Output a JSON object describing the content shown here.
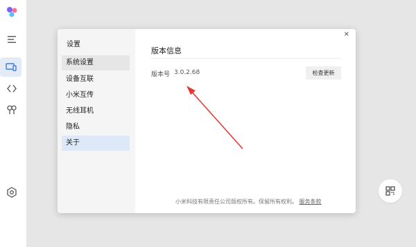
{
  "app": {
    "rail_icons": [
      "app-logo-icon",
      "menu-icon",
      "device-icon",
      "interconnect-icon",
      "earbuds-icon",
      "settings-icon"
    ]
  },
  "dialog": {
    "title": "设置",
    "close_glyph": "×",
    "nav": [
      {
        "label": "系统设置",
        "state": "hover"
      },
      {
        "label": "设备互联",
        "state": "normal"
      },
      {
        "label": "小米互传",
        "state": "normal"
      },
      {
        "label": "无线耳机",
        "state": "normal"
      },
      {
        "label": "隐私",
        "state": "normal"
      },
      {
        "label": "关于",
        "state": "selected"
      }
    ],
    "section_title": "版本信息",
    "version_label": "版本号",
    "version_value": "3.0.2.68",
    "check_update_label": "检查更新",
    "footer_text": "小米科技有限责任公司版权所有。保留所有权利。",
    "footer_link": "服务条款"
  },
  "colors": {
    "accent_selected": "#dde8f8",
    "arrow": "#e53935"
  }
}
